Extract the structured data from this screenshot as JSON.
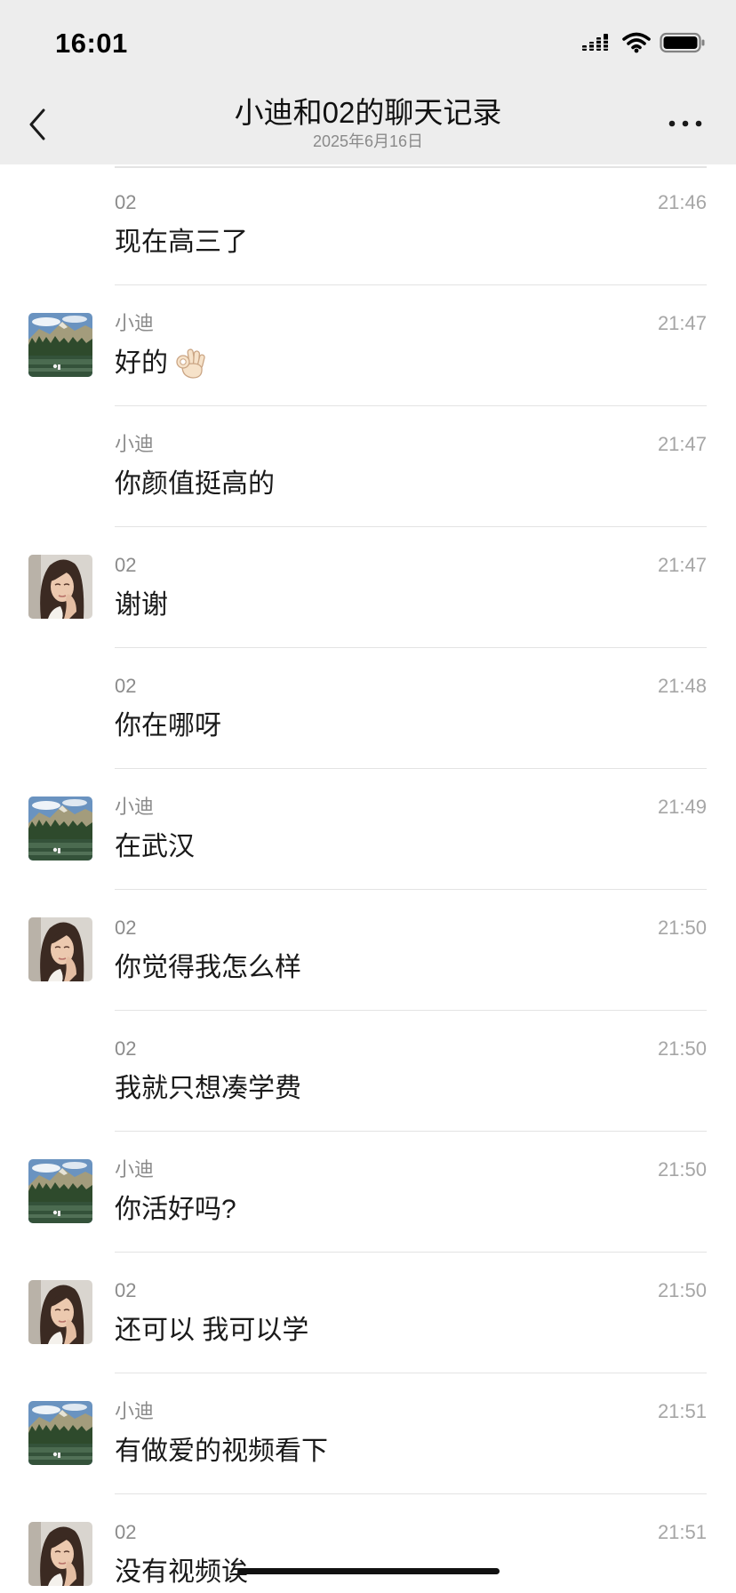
{
  "status_bar": {
    "time": "16:01",
    "signal_icon": "signal-icon",
    "wifi_icon": "wifi-icon",
    "battery_icon": "battery-icon"
  },
  "header": {
    "title": "小迪和02的聊天记录",
    "subtitle": "2025年6月16日",
    "back_icon": "chevron-left-icon",
    "more_icon": "more-icon"
  },
  "colors": {
    "header_bg": "#ededed",
    "sender_name": "#8c8c8c",
    "timestamp": "#a6a6a6",
    "message_text": "#1a1a1a",
    "divider": "#e3e3e3"
  },
  "messages": [
    {
      "sender": "02",
      "time": "21:46",
      "text": "现在高三了",
      "avatar": null
    },
    {
      "sender": "小迪",
      "time": "21:47",
      "text": "好的",
      "emoji": "ok-hand-emoji",
      "avatar": "landscape-avatar"
    },
    {
      "sender": "小迪",
      "time": "21:47",
      "text": "你颜值挺高的",
      "avatar": null
    },
    {
      "sender": "02",
      "time": "21:47",
      "text": "谢谢",
      "avatar": "portrait-avatar"
    },
    {
      "sender": "02",
      "time": "21:48",
      "text": "你在哪呀",
      "avatar": null
    },
    {
      "sender": "小迪",
      "time": "21:49",
      "text": "在武汉",
      "avatar": "landscape-avatar"
    },
    {
      "sender": "02",
      "time": "21:50",
      "text": "你觉得我怎么样",
      "avatar": "portrait-avatar"
    },
    {
      "sender": "02",
      "time": "21:50",
      "text": "我就只想凑学费",
      "avatar": null
    },
    {
      "sender": "小迪",
      "time": "21:50",
      "text": "你活好吗?",
      "avatar": "landscape-avatar"
    },
    {
      "sender": "02",
      "time": "21:50",
      "text": "还可以 我可以学",
      "avatar": "portrait-avatar"
    },
    {
      "sender": "小迪",
      "time": "21:51",
      "text": "有做爱的视频看下",
      "avatar": "landscape-avatar"
    },
    {
      "sender": "02",
      "time": "21:51",
      "text": "没有视频诶",
      "avatar": "portrait-avatar"
    }
  ]
}
